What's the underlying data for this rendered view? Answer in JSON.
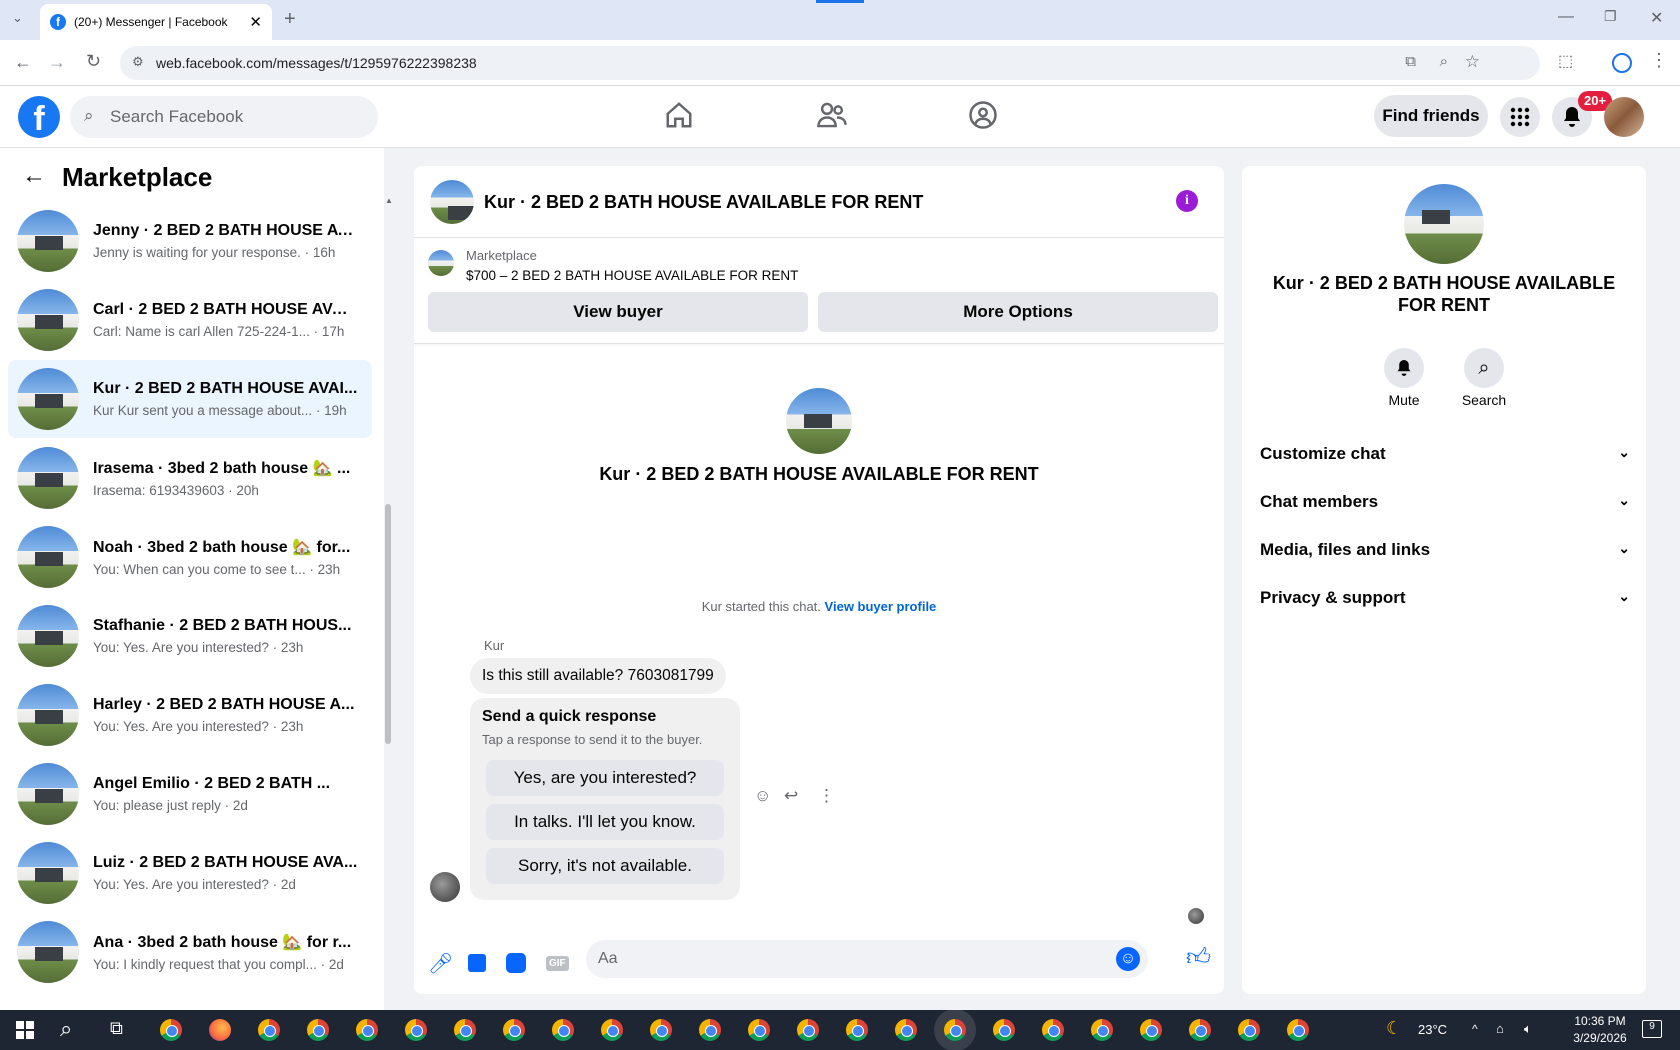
{
  "browser": {
    "tab_title": "(20+) Messenger | Facebook",
    "url": "web.facebook.com/messages/t/1295976222398238"
  },
  "fb": {
    "search_placeholder": "Search Facebook",
    "find_friends": "Find friends",
    "notif_count": "20+"
  },
  "left": {
    "title": "Marketplace",
    "conversations": [
      {
        "title": "Jenny · 2 BED 2 BATH HOUSE AV...",
        "sub": "Jenny is waiting for your response. · 16h"
      },
      {
        "title": "Carl · 2 BED 2 BATH HOUSE AVAI...",
        "sub": "Carl: Name is carl Allen 725-224-1... · 17h"
      },
      {
        "title": "Kur · 2 BED 2 BATH HOUSE AVAI...",
        "sub": "Kur Kur sent you a message about... · 19h"
      },
      {
        "title": "Irasema · 3bed 2 bath house 🏡 ...",
        "sub": "Irasema: 6193439603 · 20h"
      },
      {
        "title": "Noah · 3bed 2 bath house 🏡 for...",
        "sub": "You: When can you come to see t... · 23h"
      },
      {
        "title": "Stafhanie · 2 BED 2 BATH HOUS...",
        "sub": "You: Yes. Are you interested? · 23h"
      },
      {
        "title": "Harley · 2 BED 2 BATH HOUSE A...",
        "sub": "You: Yes. Are you interested? · 23h"
      },
      {
        "title": "Angel Emilio · 2 BED 2 BATH ...",
        "sub": "You: please just reply · 2d"
      },
      {
        "title": "Luiz · 2 BED 2 BATH HOUSE AVA...",
        "sub": "You: Yes. Are you interested? · 2d"
      },
      {
        "title": "Ana · 3bed 2 bath house 🏡 for r...",
        "sub": "You: I kindly request that you compl... · 2d"
      }
    ]
  },
  "chat": {
    "header_title": "Kur · 2 BED 2 BATH HOUSE AVAILABLE FOR RENT",
    "listing_source": "Marketplace",
    "listing_title": "$700 – 2 BED 2 BATH HOUSE AVAILABLE FOR RENT",
    "view_buyer": "View buyer",
    "more_options": "More Options",
    "center_title": "Kur · 2 BED 2 BATH HOUSE AVAILABLE FOR RENT",
    "started_text": "Kur started this chat.",
    "view_buyer_profile": "View buyer profile",
    "sender": "Kur",
    "message": "Is this still available? 7603081799",
    "quick_title": "Send a quick response",
    "quick_sub": "Tap a response to send it to the buyer.",
    "quick_replies": [
      "Yes, are you interested?",
      "In talks. I'll let you know.",
      "Sorry, it's not available."
    ],
    "composer_placeholder": "Aa"
  },
  "right": {
    "title": "Kur · 2 BED 2 BATH HOUSE AVAILABLE FOR RENT",
    "mute": "Mute",
    "search": "Search",
    "sections": [
      "Customize chat",
      "Chat members",
      "Media, files and links",
      "Privacy & support"
    ]
  },
  "taskbar": {
    "weather": "23°C",
    "time": "10:36 PM",
    "date": "3/29/2026",
    "notif": "9"
  }
}
